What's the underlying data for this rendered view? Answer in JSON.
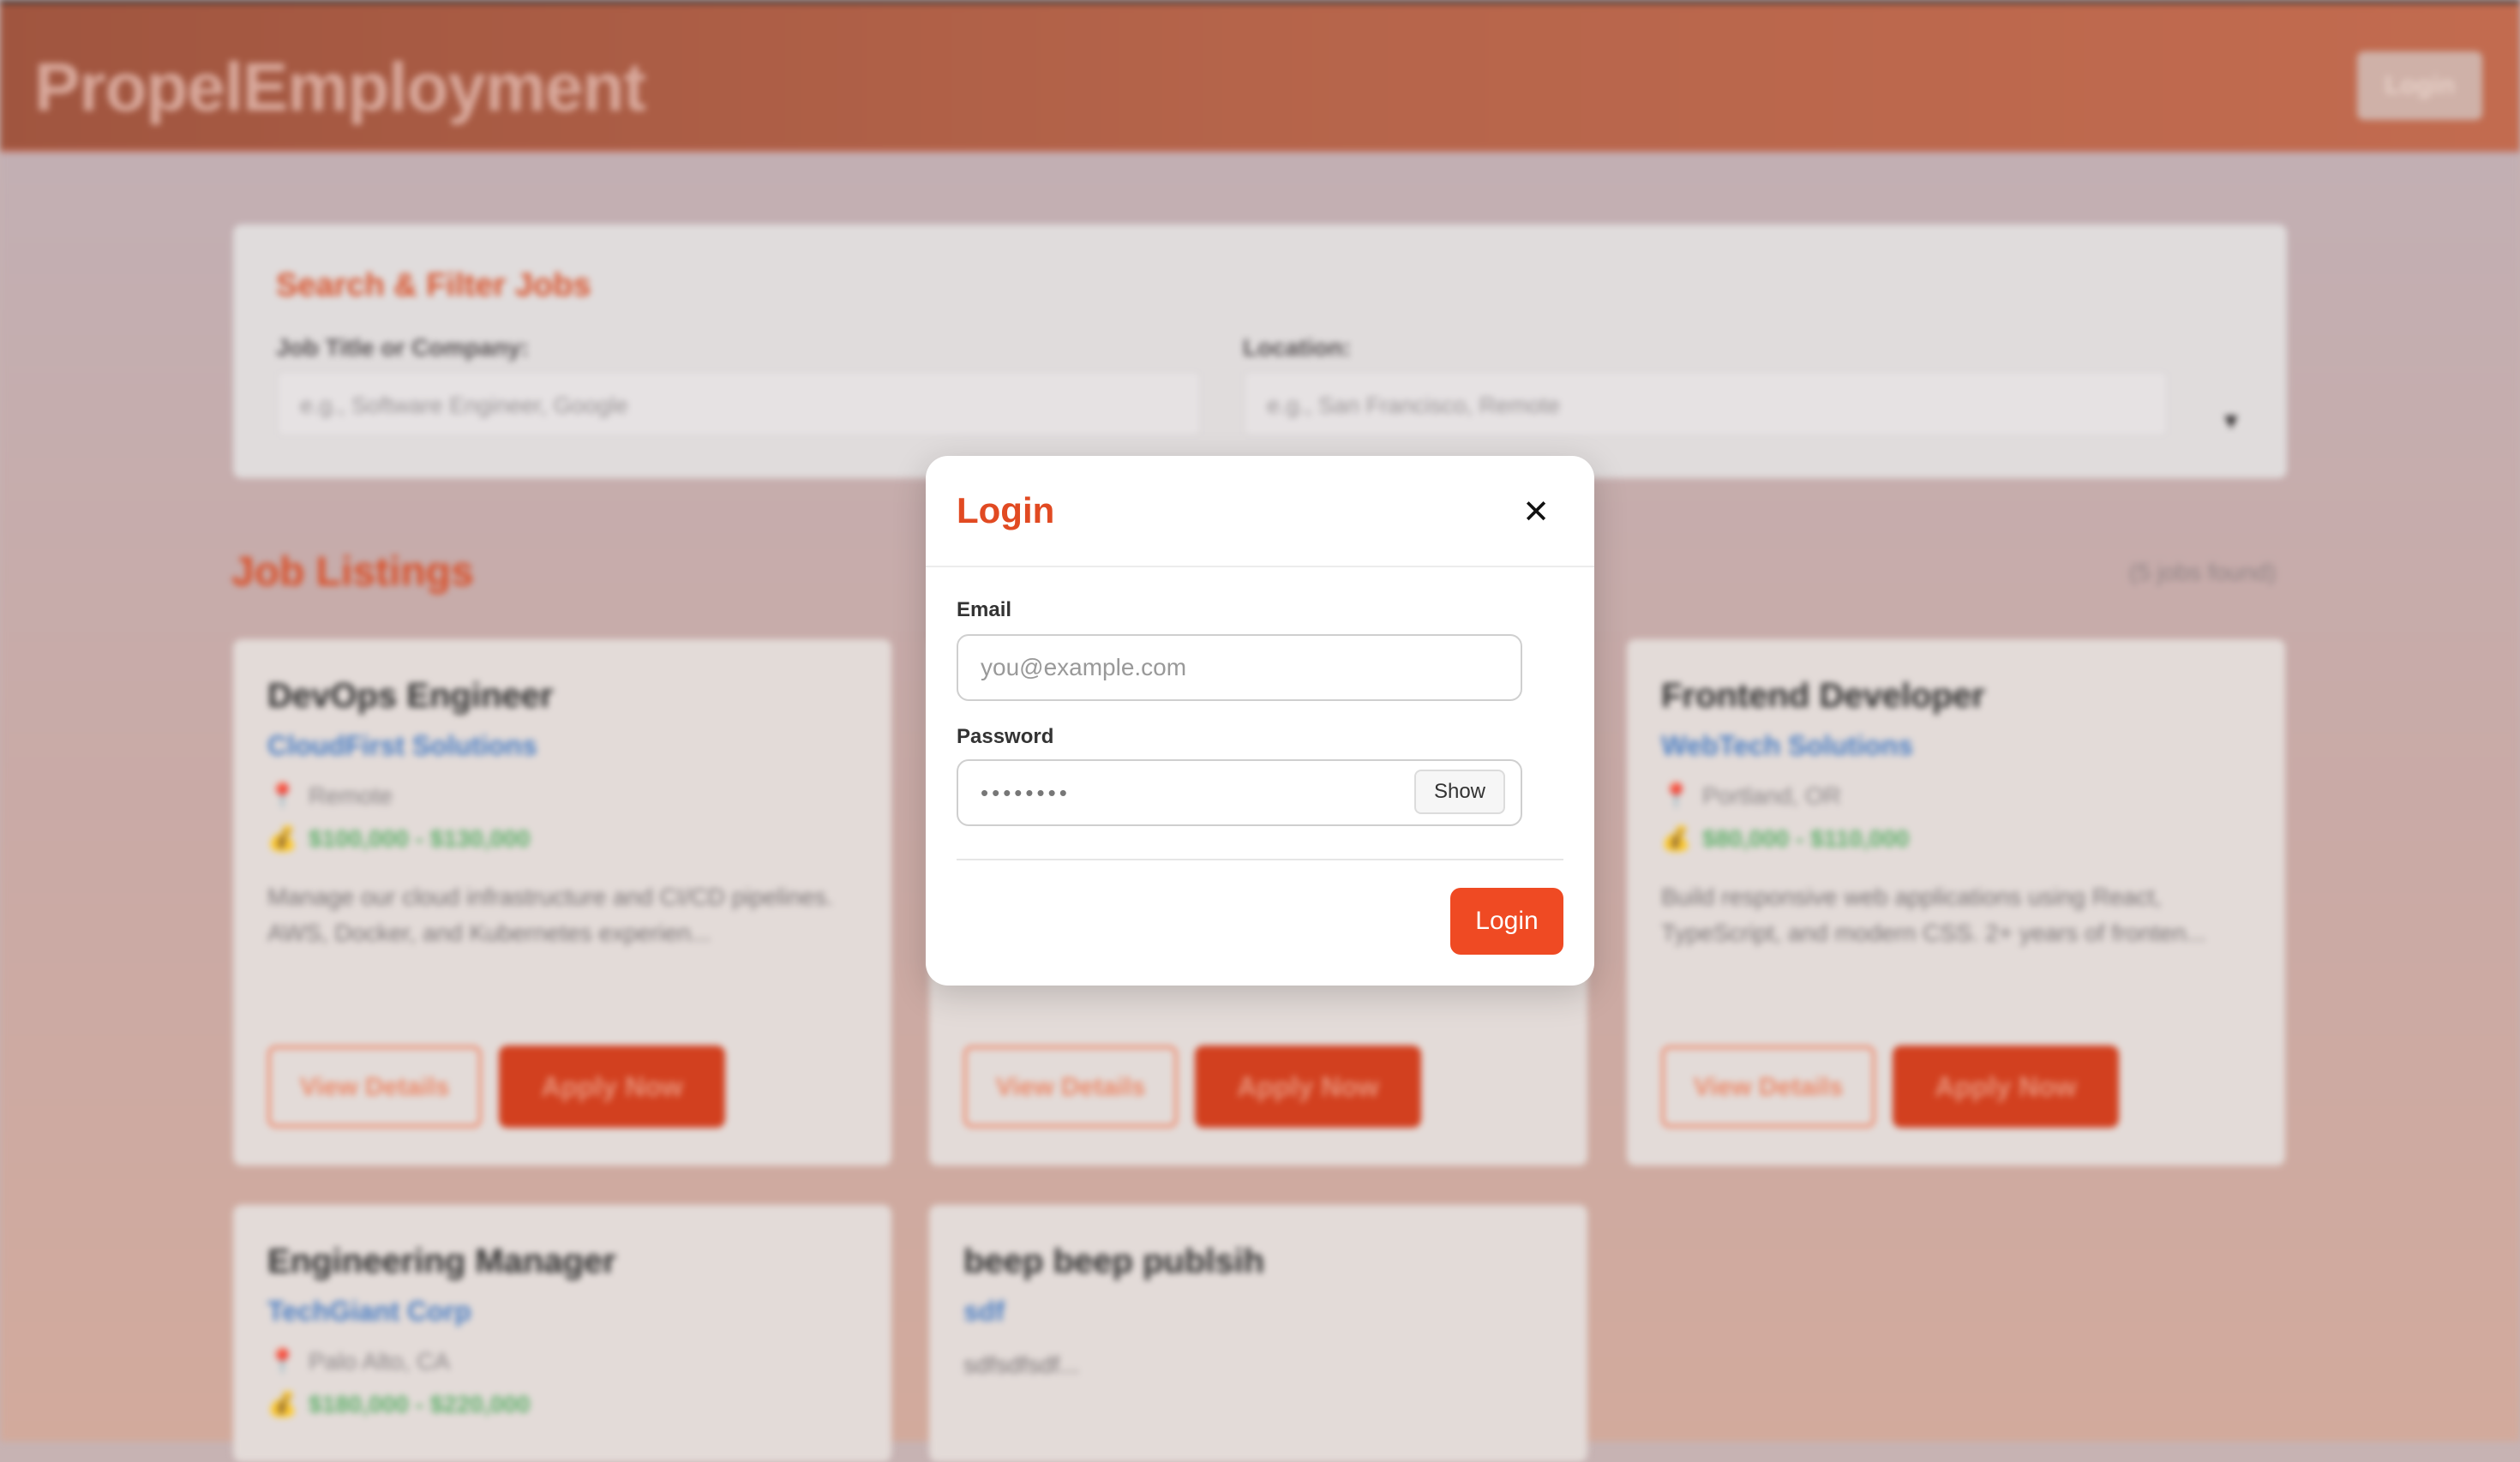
{
  "header": {
    "brand": "PropelEmployment",
    "login_label": "Login"
  },
  "filter": {
    "title": "Search & Filter Jobs",
    "job_label": "Job Title or Company:",
    "job_placeholder": "e.g., Software Engineer, Google",
    "location_label": "Location:",
    "location_placeholder": "e.g., San Francisco, Remote",
    "caret": "▼"
  },
  "listings": {
    "title": "Job Listings",
    "count": "(5 jobs found)",
    "view_label": "View Details",
    "apply_label": "Apply Now",
    "pin_icon": "📍",
    "money_icon": "💰",
    "jobs": [
      {
        "title": "DevOps Engineer",
        "company": "CloudFirst Solutions",
        "location": "Remote",
        "salary": "$100,000 - $130,000",
        "description": "Manage our cloud infrastructure and CI/CD pipelines. AWS, Docker, and Kubernetes experien..."
      },
      {
        "title": "",
        "company": "",
        "location": "",
        "salary": "",
        "description": ""
      },
      {
        "title": "Frontend Developer",
        "company": "WebTech Solutions",
        "location": "Portland, OR",
        "salary": "$80,000 - $110,000",
        "description": "Build responsive web applications using React, TypeScript, and modern CSS. 2+ years of fronten..."
      },
      {
        "title": "Engineering Manager",
        "company": "TechGiant Corp",
        "location": "Palo Alto, CA",
        "salary": "$180,000 - $220,000",
        "description": ""
      },
      {
        "title": "beep beep publsih",
        "company": "sdf",
        "location": "",
        "salary": "",
        "description": "sdfsdfsdf..."
      }
    ]
  },
  "modal": {
    "title": "Login",
    "close_icon": "✕",
    "email_label": "Email",
    "email_placeholder": "you@example.com",
    "password_label": "Password",
    "password_value": "••••••••",
    "show_label": "Show",
    "submit_label": "Login"
  },
  "colors": {
    "accent": "#ef4a23",
    "link": "#4a7ec4",
    "salary": "#5fb06b"
  }
}
